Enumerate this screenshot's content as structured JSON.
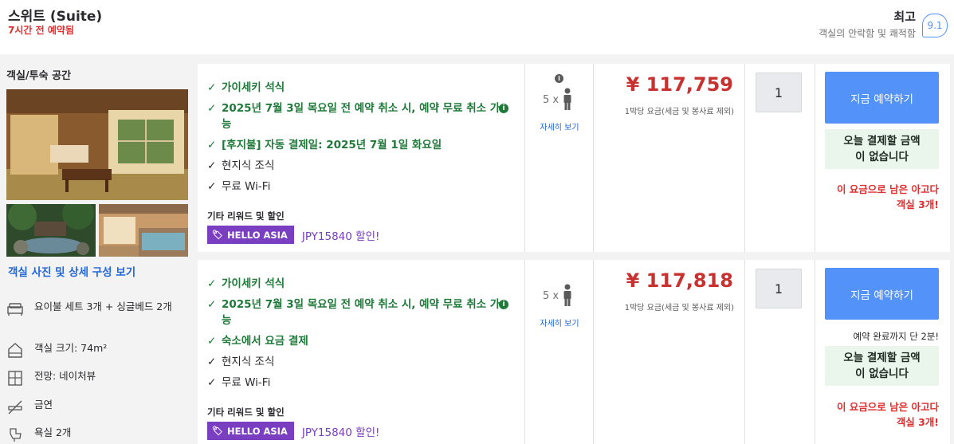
{
  "header": {
    "room_title": "스위트 (Suite)",
    "booked_ago": "7시간 전 예약됨",
    "rating_word": "최고",
    "rating_sub": "객실의 안락함 및 쾌적함",
    "rating_score": "9.1"
  },
  "left": {
    "title": "객실/투숙 공간",
    "photo_link": "객실 사진 및 상세 구성 보기",
    "amenities": [
      {
        "icon": "bed-icon",
        "text": "요이불 세트 3개 + 싱글베드 2개"
      },
      {
        "icon": "room-size-icon",
        "text": "객실 크기: 74m²"
      },
      {
        "icon": "window-view-icon",
        "text": "전망: 네이처뷰"
      },
      {
        "icon": "no-smoking-icon",
        "text": "금연"
      },
      {
        "icon": "bathtub-icon",
        "text": "욕실 2개"
      }
    ]
  },
  "rows": [
    {
      "benefits": [
        {
          "text": "가이세키 석식",
          "style": "green",
          "info": false
        },
        {
          "text": "2025년 7월 3일 목요일 전 예약 취소 시, 예약 무료 취소 가능",
          "style": "green",
          "info": true
        },
        {
          "text": "[후지불] 자동 결제일: 2025년 7월 1일 화요일",
          "style": "green",
          "info": false
        },
        {
          "text": "현지식 조식",
          "style": "black",
          "info": false
        },
        {
          "text": "무료 Wi-Fi",
          "style": "black",
          "info": false
        }
      ],
      "rewards_title": "기타 리워드 및 할인",
      "promo_badge": "HELLO ASIA",
      "promo_text": "JPY15840 할인!",
      "occupancy": "5 x",
      "occupancy_more": "자세히 보기",
      "price": "¥ 117,759",
      "price_note": "1박당 요금(세금 및 봉사료 제외)",
      "qty": "1",
      "book_label": "지금 예약하기",
      "urgency": "",
      "pay_none": "오늘 결제할 금액\n이 없습니다",
      "rooms_left": "이 요금으로 남은 아고다\n객실 3개!"
    },
    {
      "benefits": [
        {
          "text": "가이세키 석식",
          "style": "green",
          "info": false
        },
        {
          "text": "2025년 7월 3일 목요일 전 예약 취소 시, 예약 무료 취소 가능",
          "style": "green",
          "info": true
        },
        {
          "text": "숙소에서 요금 결제",
          "style": "green",
          "info": false
        },
        {
          "text": "현지식 조식",
          "style": "black",
          "info": false
        },
        {
          "text": "무료 Wi-Fi",
          "style": "black",
          "info": false
        }
      ],
      "rewards_title": "기타 리워드 및 할인",
      "promo_badge": "HELLO ASIA",
      "promo_text": "JPY15840 할인!",
      "occupancy": "5 x",
      "occupancy_more": "자세히 보기",
      "price": "¥ 117,818",
      "price_note": "1박당 요금(세금 및 봉사료 제외)",
      "qty": "1",
      "book_label": "지금 예약하기",
      "urgency": "예약 완료까지 단 2분!",
      "pay_none": "오늘 결제할 금액\n이 없습니다",
      "rooms_left": "이 요금으로 남은 아고다\n객실 3개!"
    }
  ],
  "colors": {
    "accent_blue": "#5392f9",
    "price_red": "#c7312f",
    "benefit_green": "#1f7a3a",
    "promo_purple": "#7a3fc1"
  }
}
